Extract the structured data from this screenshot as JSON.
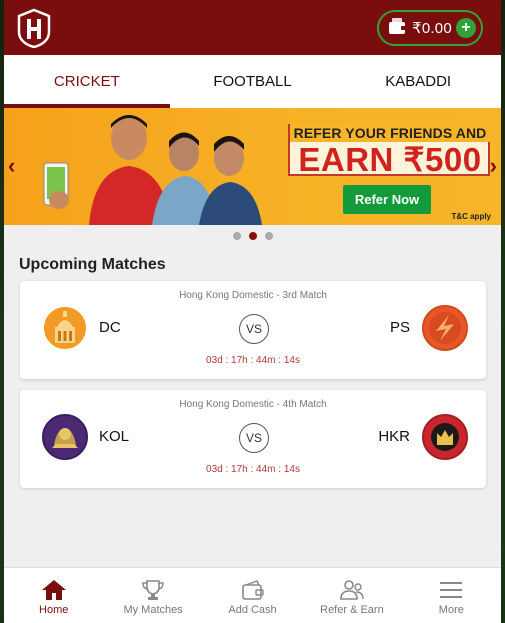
{
  "header": {
    "wallet_amount": "₹0.00",
    "add_label": "+"
  },
  "tabs": [
    {
      "label": "CRICKET",
      "active": true
    },
    {
      "label": "FOOTBALL",
      "active": false
    },
    {
      "label": "KABADDI",
      "active": false
    }
  ],
  "banner": {
    "line1": "REFER YOUR FRIENDS AND",
    "line2": "EARN ₹500",
    "button": "Refer Now",
    "terms": "T&C apply",
    "prev_arrow": "‹",
    "next_arrow": "›"
  },
  "carousel": {
    "count": 3,
    "active_index": 1
  },
  "section_title": "Upcoming Matches",
  "matches": [
    {
      "title": "Hong Kong Domestic - 3rd Match",
      "team1": "DC",
      "team2": "PS",
      "vs": "VS",
      "countdown": "03d : 17h : 44m : 14s",
      "team1_color": "#f19a24",
      "team2_color": "#e7572a"
    },
    {
      "title": "Hong Kong Domestic - 4th Match",
      "team1": "KOL",
      "team2": "HKR",
      "vs": "VS",
      "countdown": "03d : 17h : 44m : 14s",
      "team1_color": "#4b2a73",
      "team2_color": "#c9252c"
    }
  ],
  "nav": [
    {
      "label": "Home",
      "icon": "home-icon",
      "active": true
    },
    {
      "label": "My Matches",
      "icon": "trophy-icon",
      "active": false
    },
    {
      "label": "Add Cash",
      "icon": "wallet-icon",
      "active": false
    },
    {
      "label": "Refer & Earn",
      "icon": "users-icon",
      "active": false
    },
    {
      "label": "More",
      "icon": "menu-icon",
      "active": false
    }
  ],
  "colors": {
    "brand": "#7a0d0d",
    "accent_green": "#2fa33a",
    "banner_orange": "#f7b226"
  }
}
